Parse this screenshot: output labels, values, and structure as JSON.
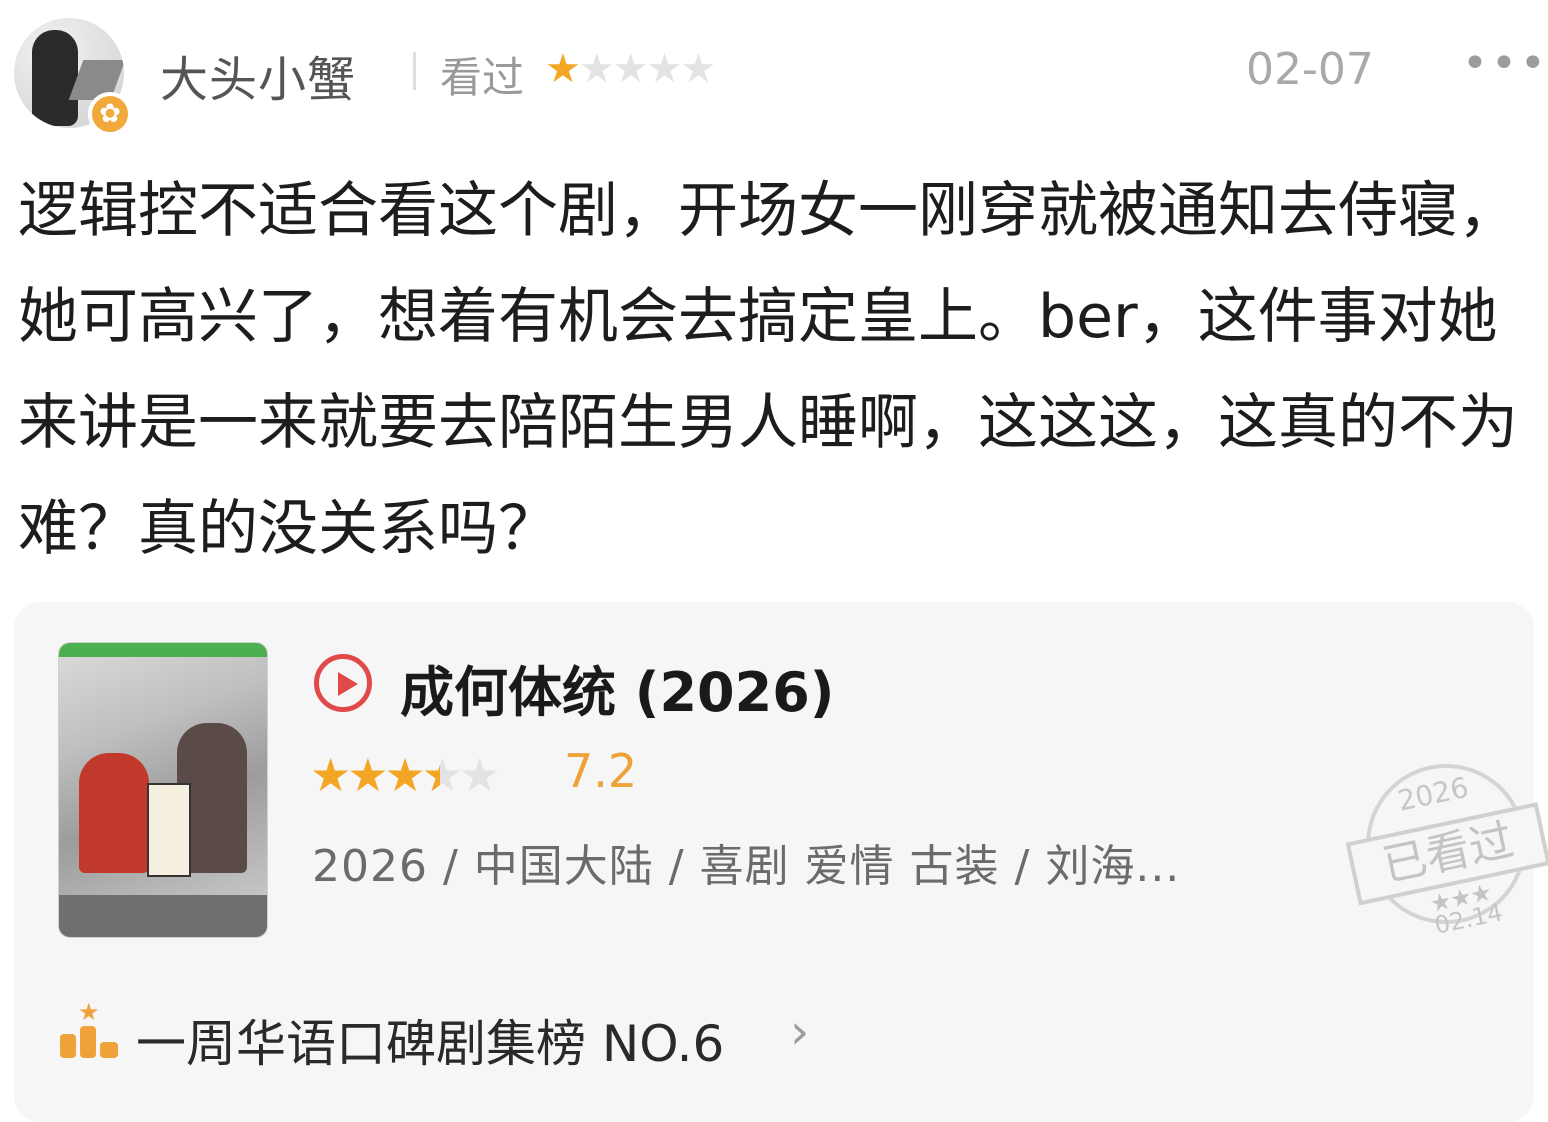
{
  "user": {
    "name": "大头小蟹",
    "status": "看过",
    "rating_stars": 1,
    "date": "02-07",
    "more": "•••",
    "badge_icon": "flower-badge-icon"
  },
  "review": {
    "text": "逻辑控不适合看这个剧，开场女一刚穿就被通知去侍寝，她可高兴了，想着有机会去搞定皇上。ber，这件事对她来讲是一来就要去陪陌生男人睡啊，这这这，这真的不为难？真的没关系吗？"
  },
  "card": {
    "title": "成何体统 (2026)",
    "rating": "7.2",
    "rating_stars": 3.5,
    "meta": "2026 / 中国大陆 / 喜剧 爱情 古装 / 刘海...",
    "stamp": {
      "year": "2026",
      "label": "已看过",
      "stars": "★★★",
      "date": "02.14"
    },
    "ranking": {
      "text": "一周华语口碑剧集榜 NO.6",
      "chevron": "›"
    }
  },
  "colors": {
    "star": "#f3a623",
    "play": "#e04a4a",
    "card_bg": "#f6f6f6"
  }
}
